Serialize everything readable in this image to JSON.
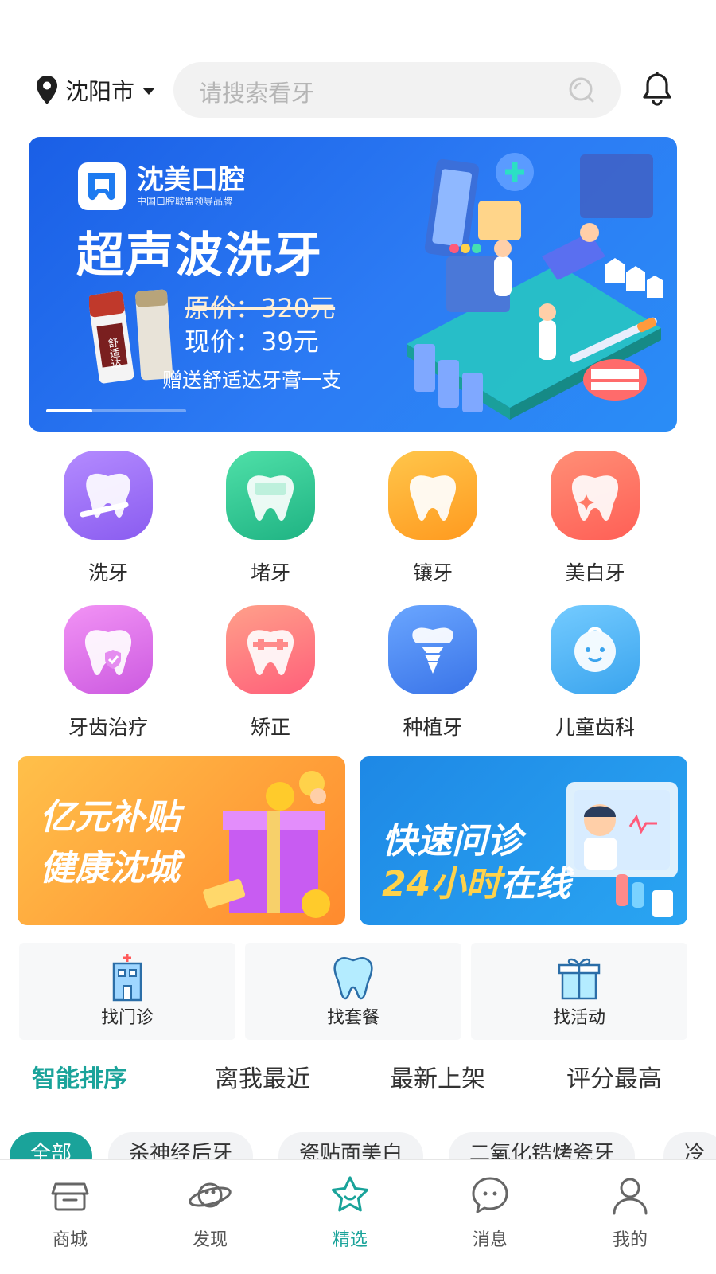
{
  "header": {
    "city": "沈阳市",
    "search_placeholder": "请搜索看牙"
  },
  "banner": {
    "brand_name": "沈美口腔",
    "brand_sub": "中国口腔联盟领导品牌",
    "title": "超声波洗牙",
    "price_old": "原价：320元",
    "price_new": "现价：39元",
    "gift": "赠送舒适达牙膏一支",
    "toothpaste_text": "舒适达"
  },
  "categories": [
    {
      "label": "洗牙",
      "icon": "tooth-brush-icon",
      "color": "#9b6cf5"
    },
    {
      "label": "堵牙",
      "icon": "tooth-filling-icon",
      "color": "#25c08d"
    },
    {
      "label": "镶牙",
      "icon": "tooth-crown-icon",
      "color": "#ffab2b"
    },
    {
      "label": "美白牙",
      "icon": "tooth-sparkle-icon",
      "color": "#ff6f5c"
    },
    {
      "label": "牙齿治疗",
      "icon": "tooth-shield-icon",
      "color": "#d86ee8"
    },
    {
      "label": "矫正",
      "icon": "tooth-braces-icon",
      "color": "#ff7b83"
    },
    {
      "label": "种植牙",
      "icon": "tooth-implant-icon",
      "color": "#4e8ef7"
    },
    {
      "label": "儿童齿科",
      "icon": "baby-face-icon",
      "color": "#4bb2f2"
    }
  ],
  "promos": {
    "left_line1": "亿元补贴",
    "left_line2": "健康沈城",
    "right_line1": "快速问诊",
    "right_line2_num": "24小时",
    "right_line2_txt": "在线"
  },
  "finders": [
    {
      "label": "找门诊",
      "icon": "clinic-building-icon"
    },
    {
      "label": "找套餐",
      "icon": "tooth-package-icon"
    },
    {
      "label": "找活动",
      "icon": "gift-box-icon"
    }
  ],
  "sorts": [
    "智能排序",
    "离我最近",
    "最新上架",
    "评分最高"
  ],
  "chips": [
    "全部",
    "杀神经后牙",
    "瓷贴面美白",
    "二氧化锆烤瓷牙",
    "冷"
  ],
  "tabs": [
    "商城",
    "发现",
    "精选",
    "消息",
    "我的"
  ],
  "colors": {
    "accent": "#1aa39a",
    "banner_blue": "#2a7cf3"
  }
}
